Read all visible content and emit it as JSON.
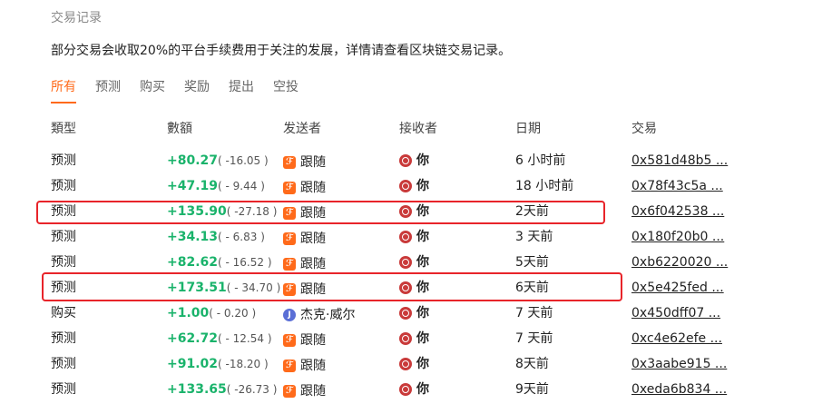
{
  "section_title": "交易记录",
  "notice": "部分交易会收取20%的平台手续费用于关注的发展，详情请查看区块链交易记录。",
  "tabs": [
    {
      "label": "所有",
      "active": true
    },
    {
      "label": "预测",
      "active": false
    },
    {
      "label": "购买",
      "active": false
    },
    {
      "label": "奖励",
      "active": false
    },
    {
      "label": "提出",
      "active": false
    },
    {
      "label": "空投",
      "active": false
    }
  ],
  "columns": {
    "type": "類型",
    "amount": "數額",
    "sender": "发送者",
    "receiver": "接收者",
    "date": "日期",
    "tx": "交易"
  },
  "rows": [
    {
      "type": "预测",
      "amount": "+80.27",
      "fee": "( -16.05 )",
      "sender": "跟随",
      "sender_icon": "follow-icon",
      "receiver": "你",
      "date": "6 小时前",
      "tx": "0x581d48b5 ..."
    },
    {
      "type": "预测",
      "amount": "+47.19",
      "fee": "( - 9.44 )",
      "sender": "跟随",
      "sender_icon": "follow-icon",
      "receiver": "你",
      "date": "18 小时前",
      "tx": "0x78f43c5a ..."
    },
    {
      "type": "预测",
      "amount": "+135.90",
      "fee": "( -27.18 )",
      "sender": "跟随",
      "sender_icon": "follow-icon",
      "receiver": "你",
      "date": "2天前",
      "tx": "0x6f042538 ..."
    },
    {
      "type": "预测",
      "amount": "+34.13",
      "fee": "( - 6.83 )",
      "sender": "跟随",
      "sender_icon": "follow-icon",
      "receiver": "你",
      "date": "3 天前",
      "tx": "0x180f20b0 ..."
    },
    {
      "type": "预测",
      "amount": "+82.62",
      "fee": "( - 16.52 )",
      "sender": "跟随",
      "sender_icon": "follow-icon",
      "receiver": "你",
      "date": "5天前",
      "tx": "0xb6220020 ..."
    },
    {
      "type": "预测",
      "amount": "+173.51",
      "fee": "( - 34.70 )",
      "sender": "跟随",
      "sender_icon": "follow-icon",
      "receiver": "你",
      "date": "6天前",
      "tx": "0x5e425fed ..."
    },
    {
      "type": "购买",
      "amount": "+1.00",
      "fee": "( - 0.20 )",
      "sender": "杰克·威尔",
      "sender_icon": "user-avatar-icon",
      "receiver": "你",
      "date": "7 天前",
      "tx": "0x450dff07 ..."
    },
    {
      "type": "预测",
      "amount": "+62.72",
      "fee": "( - 12.54 )",
      "sender": "跟随",
      "sender_icon": "follow-icon",
      "receiver": "你",
      "date": "7 天前",
      "tx": "0xc4e62efe ..."
    },
    {
      "type": "预测",
      "amount": "+91.02",
      "fee": "( -18.20 )",
      "sender": "跟随",
      "sender_icon": "follow-icon",
      "receiver": "你",
      "date": "8天前",
      "tx": "0x3aabe915 ..."
    },
    {
      "type": "预测",
      "amount": "+133.65",
      "fee": "( -26.73 )",
      "sender": "跟随",
      "sender_icon": "follow-icon",
      "receiver": "你",
      "date": "9天前",
      "tx": "0xeda6b834 ..."
    }
  ],
  "highlighted_rows": [
    2,
    5
  ],
  "colors": {
    "accent": "#ff6a1a",
    "positive": "#1ab36b",
    "highlight": "#e8242a"
  }
}
